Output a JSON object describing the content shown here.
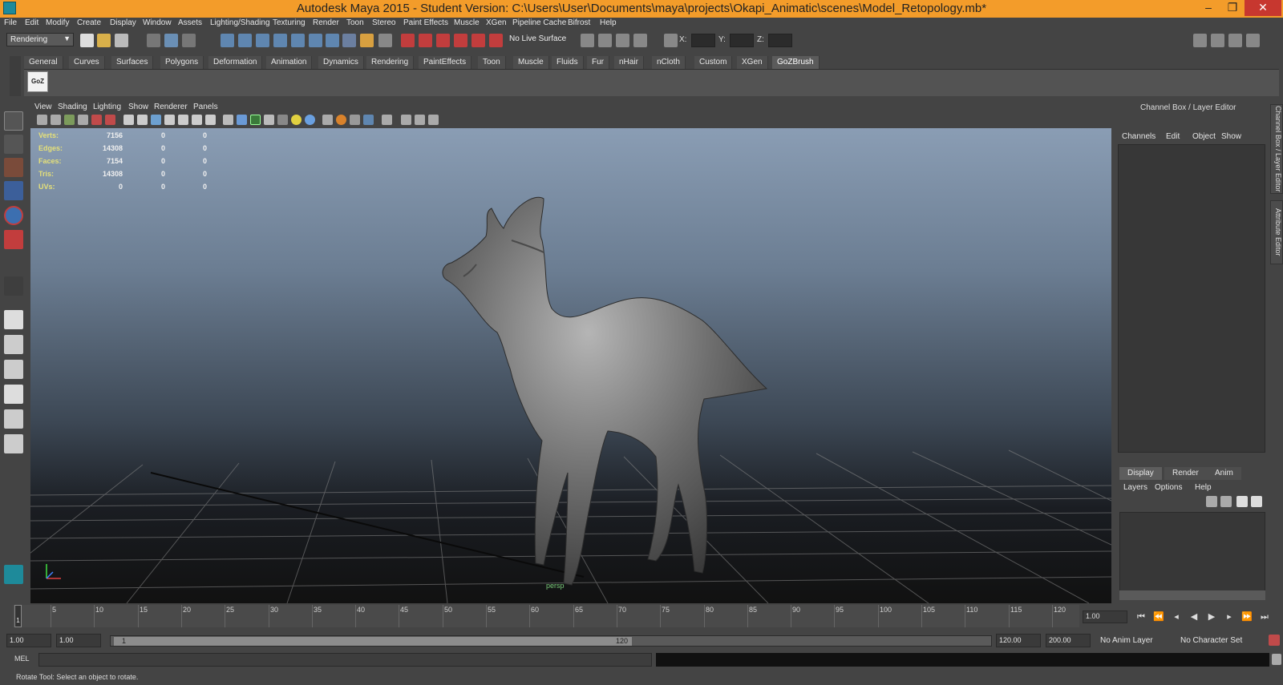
{
  "window": {
    "title": "Autodesk Maya 2015 - Student Version: C:\\Users\\User\\Documents\\maya\\projects\\Okapi_Animatic\\scenes\\Model_Retopology.mb*"
  },
  "menubar": [
    "File",
    "Edit",
    "Modify",
    "Create",
    "Display",
    "Window",
    "Assets",
    "Lighting/Shading",
    "Texturing",
    "Render",
    "Toon",
    "Stereo",
    "Paint Effects",
    "Muscle",
    "XGen",
    "Pipeline Cache",
    "Bifrost",
    "Help"
  ],
  "statusline": {
    "menuset": "Rendering",
    "live_surface": "No Live Surface",
    "x_label": "X:",
    "y_label": "Y:",
    "z_label": "Z:"
  },
  "shelf": {
    "tabs": [
      "General",
      "Curves",
      "Surfaces",
      "Polygons",
      "Deformation",
      "Animation",
      "Dynamics",
      "Rendering",
      "PaintEffects",
      "Toon",
      "Muscle",
      "Fluids",
      "Fur",
      "nHair",
      "nCloth",
      "Custom",
      "XGen",
      "GoZBrush"
    ],
    "active": "GoZBrush",
    "goz_label": "GoZ"
  },
  "panel": {
    "menu": [
      "View",
      "Shading",
      "Lighting",
      "Show",
      "Renderer",
      "Panels"
    ],
    "camera": "persp"
  },
  "hud": [
    {
      "label": "Verts:",
      "values": [
        "7156",
        "0",
        "0"
      ]
    },
    {
      "label": "Edges:",
      "values": [
        "14308",
        "0",
        "0"
      ]
    },
    {
      "label": "Faces:",
      "values": [
        "7154",
        "0",
        "0"
      ]
    },
    {
      "label": "Tris:",
      "values": [
        "14308",
        "0",
        "0"
      ]
    },
    {
      "label": "UVs:",
      "values": [
        "0",
        "0",
        "0"
      ]
    }
  ],
  "channel_box": {
    "title": "Channel Box / Layer Editor",
    "menu": [
      "Channels",
      "Edit",
      "Object",
      "Show"
    ]
  },
  "side_tabs": [
    "Channel Box / Layer Editor",
    "Attribute Editor"
  ],
  "layer_editor": {
    "tabs": [
      "Display",
      "Render",
      "Anim"
    ],
    "menu": [
      "Layers",
      "Options",
      "Help"
    ]
  },
  "timeslider": {
    "ticks": [
      "5",
      "10",
      "15",
      "20",
      "25",
      "30",
      "35",
      "40",
      "45",
      "50",
      "55",
      "60",
      "65",
      "70",
      "75",
      "80",
      "85",
      "90",
      "95",
      "100",
      "105",
      "110",
      "115",
      "120"
    ],
    "playhead": "1",
    "current": "1.00"
  },
  "rangeslider": {
    "start": "1.00",
    "start2": "1.00",
    "inner_start": "1",
    "inner_end": "120",
    "end": "120.00",
    "end2": "200.00",
    "anim_layer": "No Anim Layer",
    "char_set": "No Character Set"
  },
  "cmdline": {
    "label": "MEL"
  },
  "helpline": {
    "text": "Rotate Tool: Select an object to rotate."
  }
}
